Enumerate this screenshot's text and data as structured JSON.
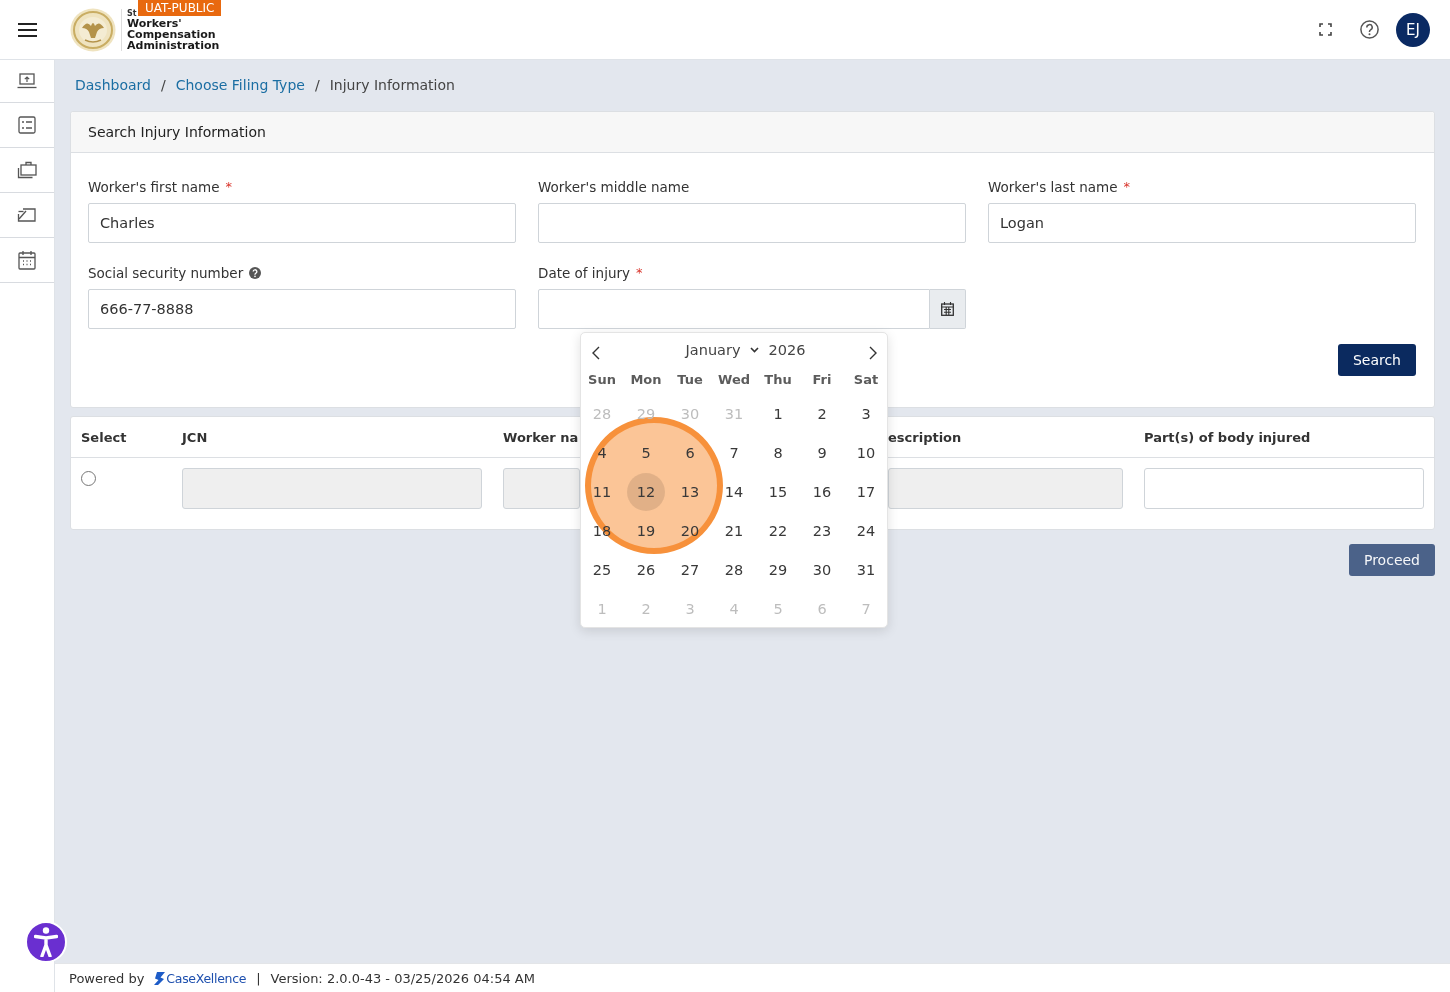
{
  "header": {
    "badge": "UAT-PUBLIC",
    "logo_small_text": "St",
    "logo_text": "Workers' Compensation Administration",
    "avatar_initials": "EJ"
  },
  "breadcrumb": [
    {
      "kind": "link",
      "label": "Dashboard"
    },
    {
      "kind": "separator",
      "label": "/"
    },
    {
      "kind": "link",
      "label": "Choose Filing Type"
    },
    {
      "kind": "separator",
      "label": "/"
    },
    {
      "kind": "current",
      "label": "Injury Information"
    }
  ],
  "search_card": {
    "title": "Search Injury Information",
    "fields": [
      {
        "kind": "text",
        "label": "Worker's first name",
        "required_mark": "*",
        "help_icon": false,
        "value": "Charles"
      },
      {
        "kind": "text",
        "label": "Worker's middle name",
        "help_icon": false
      },
      {
        "kind": "text",
        "label": "Worker's last name",
        "required_mark": "*",
        "help_icon": false,
        "value": "Logan"
      },
      {
        "kind": "text",
        "label": "Social security number",
        "help_icon": true,
        "value": "666-77-8888"
      },
      {
        "kind": "date",
        "label": "Date of injury",
        "required_mark": "*",
        "help_icon": false
      }
    ],
    "search_button": {
      "label": "Search",
      "disabled": false
    }
  },
  "datepicker": {
    "open": true,
    "month": "January",
    "year": "2026",
    "weekdays": [
      "Sun",
      "Mon",
      "Tue",
      "Wed",
      "Thu",
      "Fri",
      "Sat"
    ],
    "weeks": [
      [
        {
          "day": "28",
          "outside": true,
          "hovered": false
        },
        {
          "day": "29",
          "outside": true,
          "hovered": false
        },
        {
          "day": "30",
          "outside": true,
          "hovered": false
        },
        {
          "day": "31",
          "outside": true,
          "hovered": false
        },
        {
          "day": "1",
          "outside": false,
          "hovered": false
        },
        {
          "day": "2",
          "outside": false,
          "hovered": false
        },
        {
          "day": "3",
          "outside": false,
          "hovered": false
        }
      ],
      [
        {
          "day": "4",
          "outside": false,
          "hovered": false
        },
        {
          "day": "5",
          "outside": false,
          "hovered": false
        },
        {
          "day": "6",
          "outside": false,
          "hovered": false
        },
        {
          "day": "7",
          "outside": false,
          "hovered": false
        },
        {
          "day": "8",
          "outside": false,
          "hovered": false
        },
        {
          "day": "9",
          "outside": false,
          "hovered": false
        },
        {
          "day": "10",
          "outside": false,
          "hovered": false
        }
      ],
      [
        {
          "day": "11",
          "outside": false,
          "hovered": false
        },
        {
          "day": "12",
          "outside": false,
          "hovered": true
        },
        {
          "day": "13",
          "outside": false,
          "hovered": false
        },
        {
          "day": "14",
          "outside": false,
          "hovered": false
        },
        {
          "day": "15",
          "outside": false,
          "hovered": false
        },
        {
          "day": "16",
          "outside": false,
          "hovered": false
        },
        {
          "day": "17",
          "outside": false,
          "hovered": false
        }
      ],
      [
        {
          "day": "18",
          "outside": false,
          "hovered": false
        },
        {
          "day": "19",
          "outside": false,
          "hovered": false
        },
        {
          "day": "20",
          "outside": false,
          "hovered": false
        },
        {
          "day": "21",
          "outside": false,
          "hovered": false
        },
        {
          "day": "22",
          "outside": false,
          "hovered": false
        },
        {
          "day": "23",
          "outside": false,
          "hovered": false
        },
        {
          "day": "24",
          "outside": false,
          "hovered": false
        }
      ],
      [
        {
          "day": "25",
          "outside": false,
          "hovered": false
        },
        {
          "day": "26",
          "outside": false,
          "hovered": false
        },
        {
          "day": "27",
          "outside": false,
          "hovered": false
        },
        {
          "day": "28",
          "outside": false,
          "hovered": false
        },
        {
          "day": "29",
          "outside": false,
          "hovered": false
        },
        {
          "day": "30",
          "outside": false,
          "hovered": false
        },
        {
          "day": "31",
          "outside": false,
          "hovered": false
        }
      ],
      [
        {
          "day": "1",
          "outside": true,
          "hovered": false
        },
        {
          "day": "2",
          "outside": true,
          "hovered": false
        },
        {
          "day": "3",
          "outside": true,
          "hovered": false
        },
        {
          "day": "4",
          "outside": true,
          "hovered": false
        },
        {
          "day": "5",
          "outside": true,
          "hovered": false
        },
        {
          "day": "6",
          "outside": true,
          "hovered": false
        },
        {
          "day": "7",
          "outside": true,
          "hovered": false
        }
      ]
    ],
    "click_marker": {
      "kind": "circle"
    }
  },
  "results_table": {
    "columns": [
      "Select",
      "JCN",
      "Worker na",
      "escription",
      "Part(s) of body injured"
    ],
    "rows": [
      {
        "selected": false,
        "cells": [
          {
            "disabled": true
          },
          {
            "disabled": true
          },
          {
            "disabled": true
          },
          {
            "disabled": false
          }
        ]
      }
    ]
  },
  "proceed_button": {
    "label": "Proceed",
    "disabled": true
  },
  "footer": {
    "powered_by": "Powered by",
    "brand": "CaseXellence",
    "separator": "|",
    "version": "Version: 2.0.0-43 - 03/25/2026 04:54 AM"
  }
}
